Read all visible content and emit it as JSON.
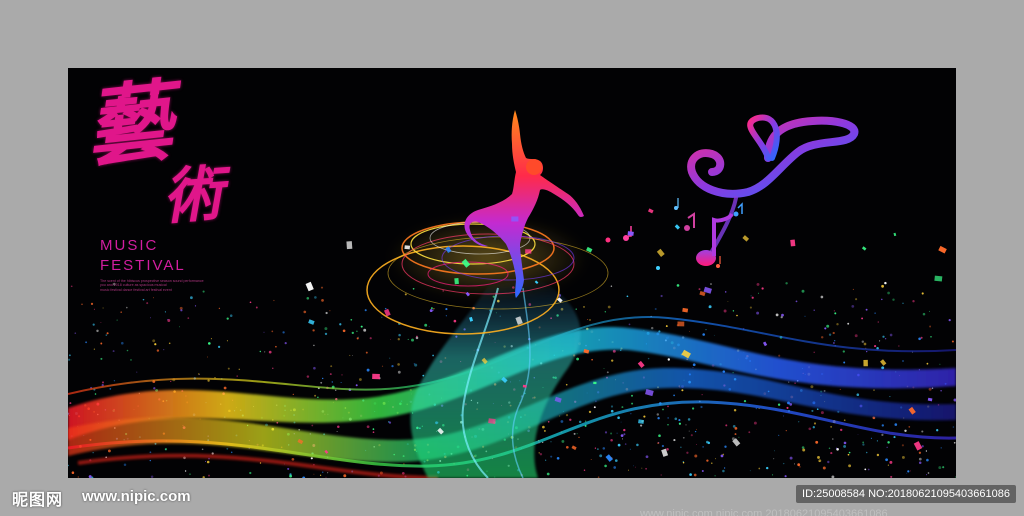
{
  "poster": {
    "calligraphy_large": "藝",
    "calligraphy_small": "術",
    "title_line1": "MUSIC",
    "title_line2": "FESTIVAL",
    "fine_print": [
      "The scent of the hibiscus prospective season sound performance",
      "you and 2018 culture as spacious musical",
      "music festival dance festival art festival event"
    ]
  },
  "watermark": {
    "logo_text": "昵图网",
    "url_text": "www.nipic.com",
    "id_text": "ID:25008584 NO:20180621095403661086",
    "faint_text": "www.nipic.com nipic.com 20180621095403661086"
  },
  "colors": {
    "page_background": "#aaaaaa",
    "poster_background": "#020204",
    "accent_magenta": "#e0168a",
    "ribbon_blue": "#1e6cff",
    "ribbon_green": "#28d870",
    "ribbon_red": "#ff2030"
  },
  "icons": {
    "dancer": "dancer-silhouette",
    "clef": "treble-clef-icon",
    "notes": "music-note-icon"
  }
}
